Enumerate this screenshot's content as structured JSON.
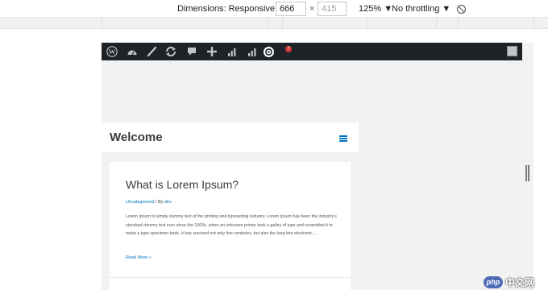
{
  "devtools": {
    "dimensions_label": "Dimensions: Responsive ▼",
    "width_value": "666",
    "times": "×",
    "height_value": "415",
    "zoom_label": "125% ▼",
    "throttle_label": "No throttling ▼"
  },
  "adminbar": {
    "icons": [
      "wordpress-icon",
      "dashboard-icon",
      "customize-brush-icon",
      "updates-icon",
      "comments-icon",
      "new-content-icon",
      "stats-icon",
      "stats-icon",
      "plugin-icon"
    ],
    "badge": "7"
  },
  "site": {
    "title": "Welcome"
  },
  "post": {
    "title": "What is Lorem Ipsum?",
    "category": "Uncategorized",
    "separator": " / By ",
    "author": "dev",
    "excerpt": "Lorem Ipsum is simply dummy text of the printing and typesetting industry. Lorem Ipsum has been the industry's standard dummy text ever since the 1500s, when an unknown printer took a galley of type and scrambled it to make a type specimen book. It has survived not only five centuries, but also the leap into electronic …",
    "read_more": "Read More »"
  },
  "watermark": {
    "logo_text": "php",
    "site_text": "中文网"
  },
  "colors": {
    "adminbar_bg": "#1d2327",
    "accent": "#0274be",
    "badge": "#d63638"
  }
}
